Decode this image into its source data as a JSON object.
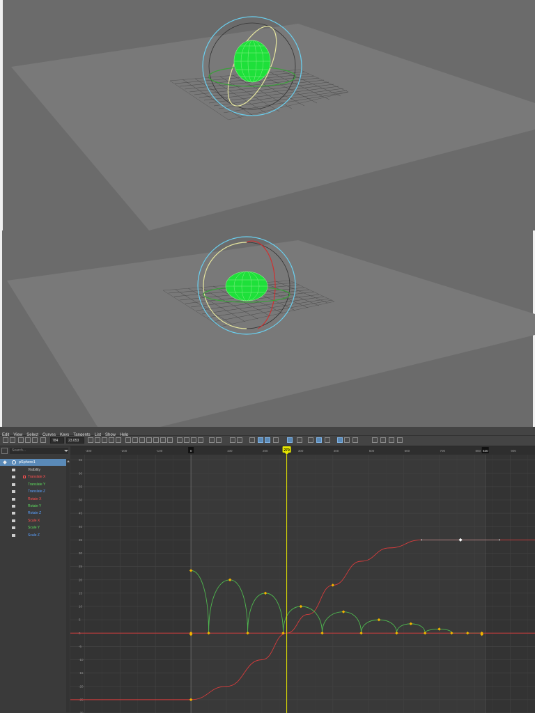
{
  "graph_editor": {
    "menu": [
      "Edit",
      "View",
      "Select",
      "Curves",
      "Keys",
      "Tangents",
      "List",
      "Show",
      "Help"
    ],
    "toolbar": {
      "frame_value": "784",
      "value_field": "23.053"
    },
    "search_placeholder": "Search...",
    "object_name": "pSphere1",
    "channels": [
      {
        "label": "Visibility",
        "color": "#c8c8c8"
      },
      {
        "label": "Translate X",
        "color": "#ff5050"
      },
      {
        "label": "Translate Y",
        "color": "#5ddc5d"
      },
      {
        "label": "Translate Z",
        "color": "#5aa0ff"
      },
      {
        "label": "Rotate X",
        "color": "#ff5050"
      },
      {
        "label": "Rotate Y",
        "color": "#5ddc5d"
      },
      {
        "label": "Rotate Z",
        "color": "#5aa0ff"
      },
      {
        "label": "Scale X",
        "color": "#ff5050"
      },
      {
        "label": "Scale Y",
        "color": "#5ddc5d"
      },
      {
        "label": "Scale Z",
        "color": "#5aa0ff"
      }
    ],
    "time_labels": [
      "-300",
      "-200",
      "-100",
      "0",
      "100",
      "200",
      "300",
      "400",
      "500",
      "600",
      "700",
      "800",
      "900"
    ],
    "current_frame": "270",
    "range_start": "0",
    "range_end": "830",
    "value_labels": [
      "65",
      "60",
      "55",
      "50",
      "45",
      "40",
      "35",
      "30",
      "25",
      "20",
      "15",
      "10",
      "5",
      "0",
      "-5",
      "-10",
      "-15",
      "-20",
      "-25",
      "-30"
    ],
    "colors": {
      "red_curve": "#d83c3c",
      "green_curve": "#4fb84f",
      "key": "#f2b400",
      "time_cursor": "#e8e800",
      "background": "#393939"
    }
  },
  "chart_data": {
    "type": "line",
    "x_unit": "frame",
    "xlim": [
      -340,
      970
    ],
    "ylim": [
      -30,
      67
    ],
    "series": [
      {
        "name": "Translate X",
        "color": "#d83c3c",
        "points": [
          [
            -340,
            -25
          ],
          [
            0,
            -25
          ],
          [
            100,
            -20
          ],
          [
            200,
            -10
          ],
          [
            270,
            0
          ],
          [
            330,
            7
          ],
          [
            400,
            18
          ],
          [
            480,
            27
          ],
          [
            560,
            32
          ],
          [
            650,
            35
          ],
          [
            760,
            35
          ],
          [
            870,
            35
          ],
          [
            970,
            35
          ]
        ]
      },
      {
        "name": "Translate Y",
        "color": "#4fb84f",
        "points": [
          [
            0,
            23.5
          ],
          [
            50,
            0
          ],
          [
            110,
            20
          ],
          [
            160,
            0
          ],
          [
            210,
            15
          ],
          [
            260,
            0
          ],
          [
            310,
            10
          ],
          [
            370,
            0
          ],
          [
            430,
            8
          ],
          [
            480,
            0
          ],
          [
            530,
            5
          ],
          [
            580,
            0
          ],
          [
            620,
            3.5
          ],
          [
            660,
            0
          ],
          [
            700,
            1.5
          ],
          [
            735,
            0
          ],
          [
            780,
            0
          ],
          [
            820,
            0
          ]
        ]
      },
      {
        "name": "Rotate X",
        "color": "#d83c3c",
        "points": [
          [
            -340,
            0
          ],
          [
            970,
            0
          ]
        ]
      }
    ],
    "keys": [
      [
        0,
        -25
      ],
      [
        0,
        23.5
      ],
      [
        0,
        0
      ],
      [
        0,
        -0.5
      ],
      [
        50,
        0
      ],
      [
        110,
        20
      ],
      [
        160,
        0
      ],
      [
        210,
        15
      ],
      [
        260,
        0
      ],
      [
        310,
        10
      ],
      [
        370,
        0
      ],
      [
        400,
        18
      ],
      [
        430,
        8
      ],
      [
        480,
        0
      ],
      [
        530,
        5
      ],
      [
        580,
        0
      ],
      [
        620,
        3.5
      ],
      [
        660,
        0
      ],
      [
        700,
        1.5
      ],
      [
        735,
        0
      ],
      [
        780,
        0
      ],
      [
        820,
        0
      ],
      [
        820,
        -0.5
      ]
    ]
  }
}
